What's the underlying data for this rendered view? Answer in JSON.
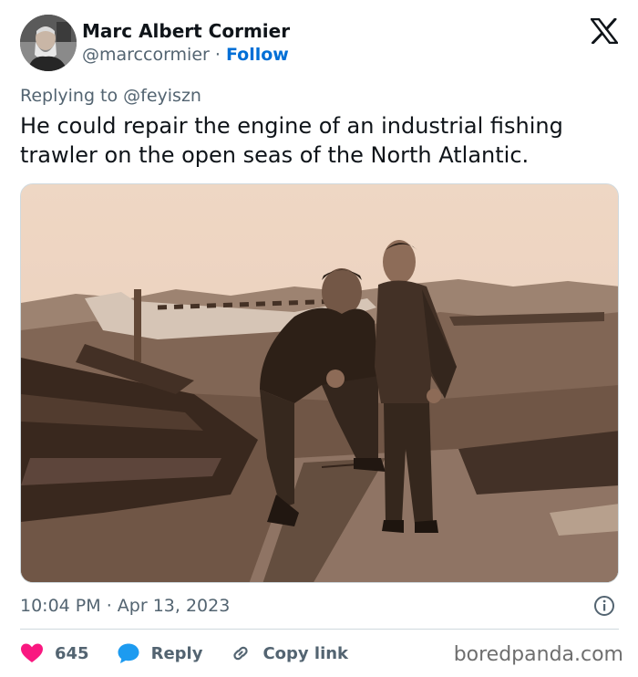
{
  "author": {
    "display_name": "Marc Albert Cormier",
    "handle": "@marccormier",
    "separator": "·",
    "follow_label": "Follow",
    "avatar_icon": "user-avatar-photo"
  },
  "platform_icon": "x-logo-icon",
  "reply": {
    "replying_to": "Replying to @feyiszn"
  },
  "tweet": {
    "text": "He could repair the engine of an industrial fishing trawler on the open seas of the North Atlantic.",
    "media_description_icon": "sepia-photo"
  },
  "meta": {
    "time": "10:04 PM",
    "separator": "·",
    "date": "Apr 13, 2023"
  },
  "actions": {
    "likes": "645",
    "reply_label": "Reply",
    "copy_link_label": "Copy link"
  },
  "watermark": "boredpanda.com",
  "colors": {
    "like": "#f91880",
    "reply": "#1d9bf0",
    "follow": "#006fd6",
    "muted": "#536471"
  }
}
